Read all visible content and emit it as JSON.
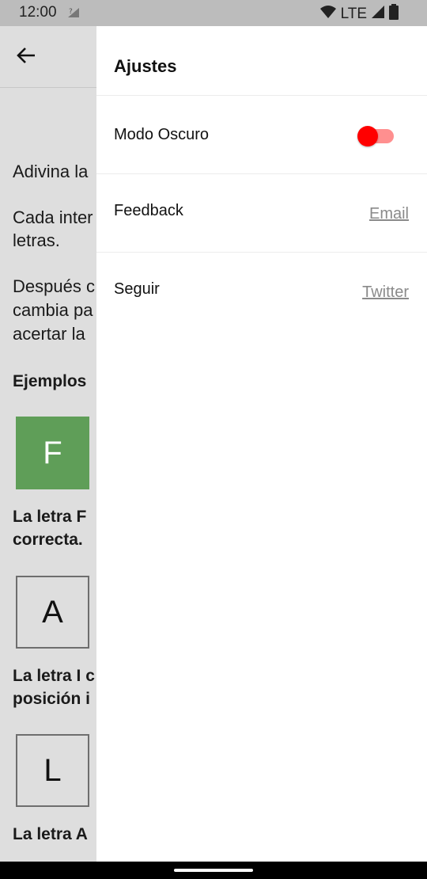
{
  "status_bar": {
    "time": "12:00",
    "network": "LTE"
  },
  "background": {
    "lines": [
      "Adivina la",
      "Cada inter",
      "letras.",
      "Después c",
      "cambia pa",
      "acertar la"
    ],
    "examples_heading": "Ejemplos",
    "tiles": [
      "F",
      "A",
      "L"
    ],
    "captions": [
      "La letra F",
      "correcta.",
      "La letra I c",
      "posición i",
      "La letra A"
    ]
  },
  "drawer": {
    "title": "Ajustes",
    "dark_mode_label": "Modo Oscuro",
    "dark_mode_on": true,
    "feedback_label": "Feedback",
    "feedback_link": "Email",
    "follow_label": "Seguir",
    "follow_link": "Twitter"
  },
  "colors": {
    "toggle_thumb": "#ff0000",
    "toggle_track": "#ff8f8f",
    "tile_correct": "#5f9e58"
  }
}
